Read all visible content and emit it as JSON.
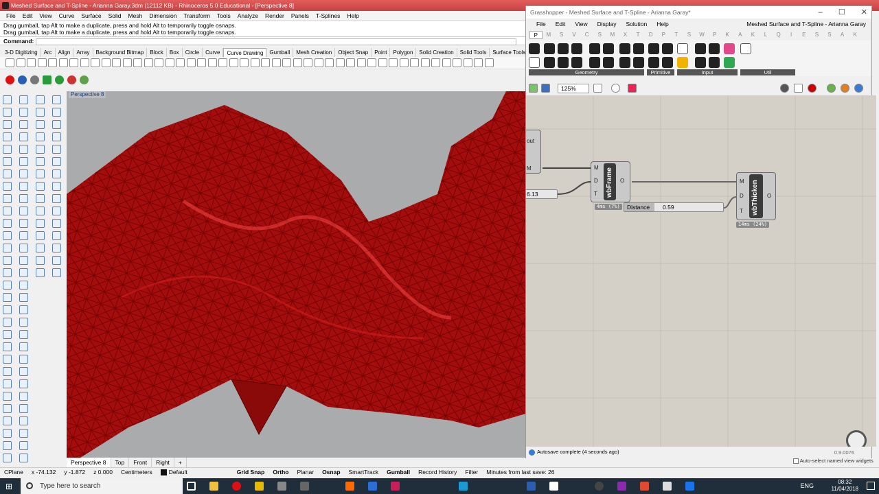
{
  "rhino": {
    "title": "Meshed Surface and T-Spline - Arianna Garay.3dm (12112 KB) - Rhinoceros 5.0 Educational - [Perspective 8]",
    "menu": [
      "File",
      "Edit",
      "View",
      "Curve",
      "Surface",
      "Solid",
      "Mesh",
      "Dimension",
      "Transform",
      "Tools",
      "Analyze",
      "Render",
      "Panels",
      "T-Splines",
      "Help"
    ],
    "history": [
      "Drag gumball, tap Alt to make a duplicate, press and hold Alt to temporarily toggle osnaps.",
      "Drag gumball, tap Alt to make a duplicate, press and hold Alt to temporarily toggle osnaps."
    ],
    "command_label": "Command:",
    "toolbar_tabs": [
      "3-D Digitizing",
      "Arc",
      "Align",
      "Array",
      "Background Bitmap",
      "Block",
      "Box",
      "Circle",
      "Curve",
      "Curve Drawing",
      "Gumball",
      "Mesh Creation",
      "Object Snap",
      "Point",
      "Polygon",
      "Solid Creation",
      "Solid Tools",
      "Surface Tools"
    ],
    "active_toolbar_tab": "Curve Drawing",
    "viewport_label": "Perspective 8",
    "viewport_tabs": [
      "Perspective 8",
      "Top",
      "Front",
      "Right"
    ],
    "viewport_add": "+",
    "status": {
      "cplane": "CPlane",
      "x": "x -74.132",
      "y": "y -1.872",
      "z": "z 0.000",
      "units": "Centimeters",
      "layer": "Default",
      "grid_snap": "Grid Snap",
      "ortho": "Ortho",
      "planar": "Planar",
      "osnap": "Osnap",
      "smarttrack": "SmartTrack",
      "gumball": "Gumball",
      "record_history": "Record History",
      "filter": "Filter",
      "minutes": "Minutes from last save: 26"
    },
    "colors": {
      "title_bar": "#d9534f",
      "mesh": "#a00000",
      "viewport_bg": "#a9abad"
    }
  },
  "gh": {
    "title": "Grasshopper - Meshed Surface and T-Spline - Arianna Garay*",
    "menu": [
      "File",
      "Edit",
      "View",
      "Display",
      "Solution",
      "Help"
    ],
    "doc_name": "Meshed Surface and T-Spline - Arianna Garay",
    "tabs": [
      "P",
      "M",
      "S",
      "V",
      "C",
      "S",
      "M",
      "X",
      "T",
      "D",
      "P",
      "T",
      "S",
      "W",
      "P",
      "K",
      "A",
      "K",
      "L",
      "Q",
      "I",
      "E",
      "S",
      "S",
      "A",
      "K"
    ],
    "groups": [
      "Geometry",
      "Primitive",
      "Input",
      "Util"
    ],
    "zoom": "125%",
    "canvas": {
      "out_label": "out",
      "m_label": "M",
      "slider_value": "6.13",
      "wbframe": {
        "name": "wbFrame",
        "inputs": [
          "M",
          "D",
          "T"
        ],
        "output": "O",
        "timing": "4ms (7%)"
      },
      "distance": {
        "label": "Distance",
        "value": "0.59"
      },
      "wbthicken": {
        "name": "wbThicken",
        "inputs": [
          "M",
          "D",
          "T"
        ],
        "output": "O",
        "timing": "14ms (24%)"
      }
    },
    "autosave": "Autosave complete (4 seconds ago)",
    "version": "0.9.0076",
    "named_view_hint": "Auto-select named view widgets"
  },
  "taskbar": {
    "search_placeholder": "Type here to search",
    "lang": "ENG",
    "time": "08:32",
    "date": "11/04/2018"
  }
}
